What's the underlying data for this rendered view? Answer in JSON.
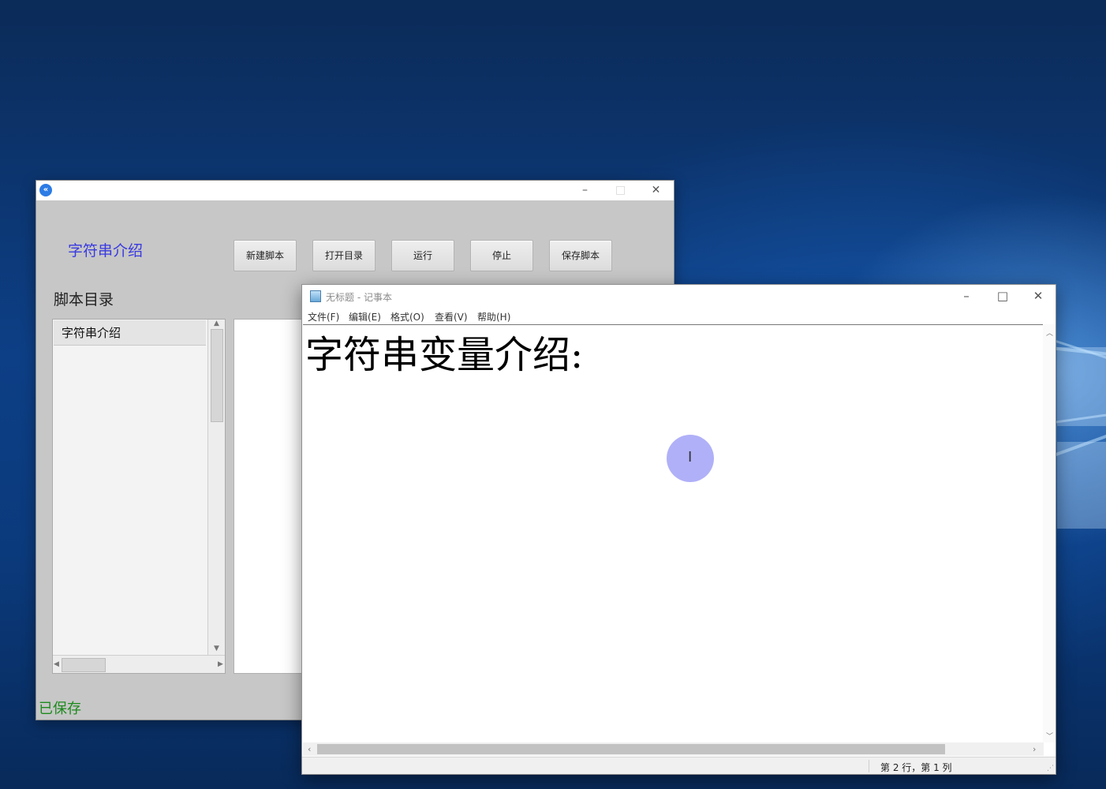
{
  "script_app": {
    "window_title": "",
    "script_title": "字符串介绍",
    "toolbar": {
      "new_script": "新建脚本",
      "open_directory": "打开目录",
      "run": "运行",
      "stop": "停止",
      "save_script": "保存脚本"
    },
    "sidebar_heading": "脚本目录",
    "scripts": [
      "字符串介绍"
    ],
    "status": "已保存",
    "controls": {
      "minimize": "–",
      "maximize": "□",
      "close": "✕"
    }
  },
  "notepad": {
    "title": "无标题 - 记事本",
    "menu": [
      "文件(F)",
      "编辑(E)",
      "格式(O)",
      "查看(V)",
      "帮助(H)"
    ],
    "content": "字符串变量介绍:",
    "status_position": "第 2 行，第 1 列",
    "controls": {
      "minimize": "–",
      "maximize": "□",
      "close": "✕"
    }
  },
  "icons": {
    "app_logo": "app-logo-icon",
    "notepad_icon": "notepad-icon",
    "cursor": "text-cursor-icon"
  },
  "colors": {
    "script_title": "#3a3ae0",
    "status_saved": "#1d8a1d",
    "cursor_highlight": "#9696f5"
  }
}
